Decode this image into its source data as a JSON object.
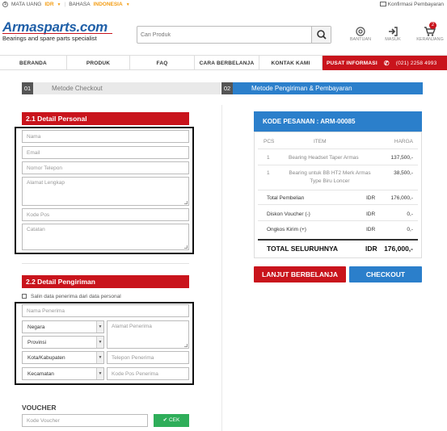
{
  "topbar": {
    "currency_label": "MATA UANG",
    "currency_value": "IDR",
    "language_label": "BAHASA",
    "language_value": "INDONESIA",
    "confirm_payment": "Konfirmasi Pembayaran"
  },
  "header": {
    "logo": "Armasparts.com",
    "tagline": "Bearings and spare parts specialist",
    "search_placeholder": "Cari Produk",
    "help": "BANTUAN",
    "login": "MASUK",
    "cart": "KERANJANG",
    "cart_count": "2"
  },
  "nav": {
    "items": [
      "BERANDA",
      "PRODUK",
      "FAQ",
      "CARA BERBELANJA",
      "KONTAK KAMI"
    ],
    "info": "PUSAT INFORMASI",
    "phone": "(021) 2258 4993"
  },
  "steps": [
    {
      "num": "01",
      "label": "Metode Checkout"
    },
    {
      "num": "02",
      "label": "Metode Pengiriman & Pembayaran"
    }
  ],
  "personal": {
    "title": "2.1 Detail Personal",
    "fields": [
      "Nama",
      "Email",
      "Nomor Telepon",
      "Alamat Lengkap",
      "Kode Pos",
      "Catatan"
    ]
  },
  "shipping": {
    "title": "2.2 Detail Pengiriman",
    "copy_label": "Salin data penerima dari data personal",
    "recipient_name": "Nama Penerima",
    "country": "Negara",
    "province": "Provinsi",
    "city": "Kota/Kabupaten",
    "district": "Kecamatan",
    "address": "Alamat Penerima",
    "phone": "Telepon Penerima",
    "postal": "Kode Pos Penerima"
  },
  "voucher": {
    "title": "VOUCHER",
    "placeholder": "Kode Voucher",
    "button": "CEK"
  },
  "order": {
    "title": "KODE PESANAN : ARM-00085",
    "columns": [
      "PCS",
      "ITEM",
      "HARGA"
    ],
    "items": [
      {
        "pcs": "1",
        "item": "Bearing Headset Taper Armas",
        "item2": "",
        "price": "137,500,-"
      },
      {
        "pcs": "1",
        "item": "Bearing untuk BB HT2 Merk Armas",
        "item2": "Type Biru Loncer",
        "price": "38,500,-"
      }
    ],
    "totals": [
      {
        "label": "Total Pembelian",
        "cur": "IDR",
        "value": "176,000,-"
      },
      {
        "label": "Diskon Voucher (-)",
        "cur": "IDR",
        "value": "0,-"
      },
      {
        "label": "Ongkos Kirim (+)",
        "cur": "IDR",
        "value": "0,-"
      }
    ],
    "grand_label": "TOTAL SELURUHNYA",
    "grand_cur": "IDR",
    "grand_value": "176,000,-",
    "continue_button": "LANJUT BERBELANJA",
    "checkout_button": "CHECKOUT"
  },
  "colors": {
    "brand_blue": "#1f5fa8",
    "accent_red": "#c9141c",
    "step_blue": "#2b7fcb",
    "ok_green": "#2fae5a",
    "currency_orange": "#f39c12"
  }
}
